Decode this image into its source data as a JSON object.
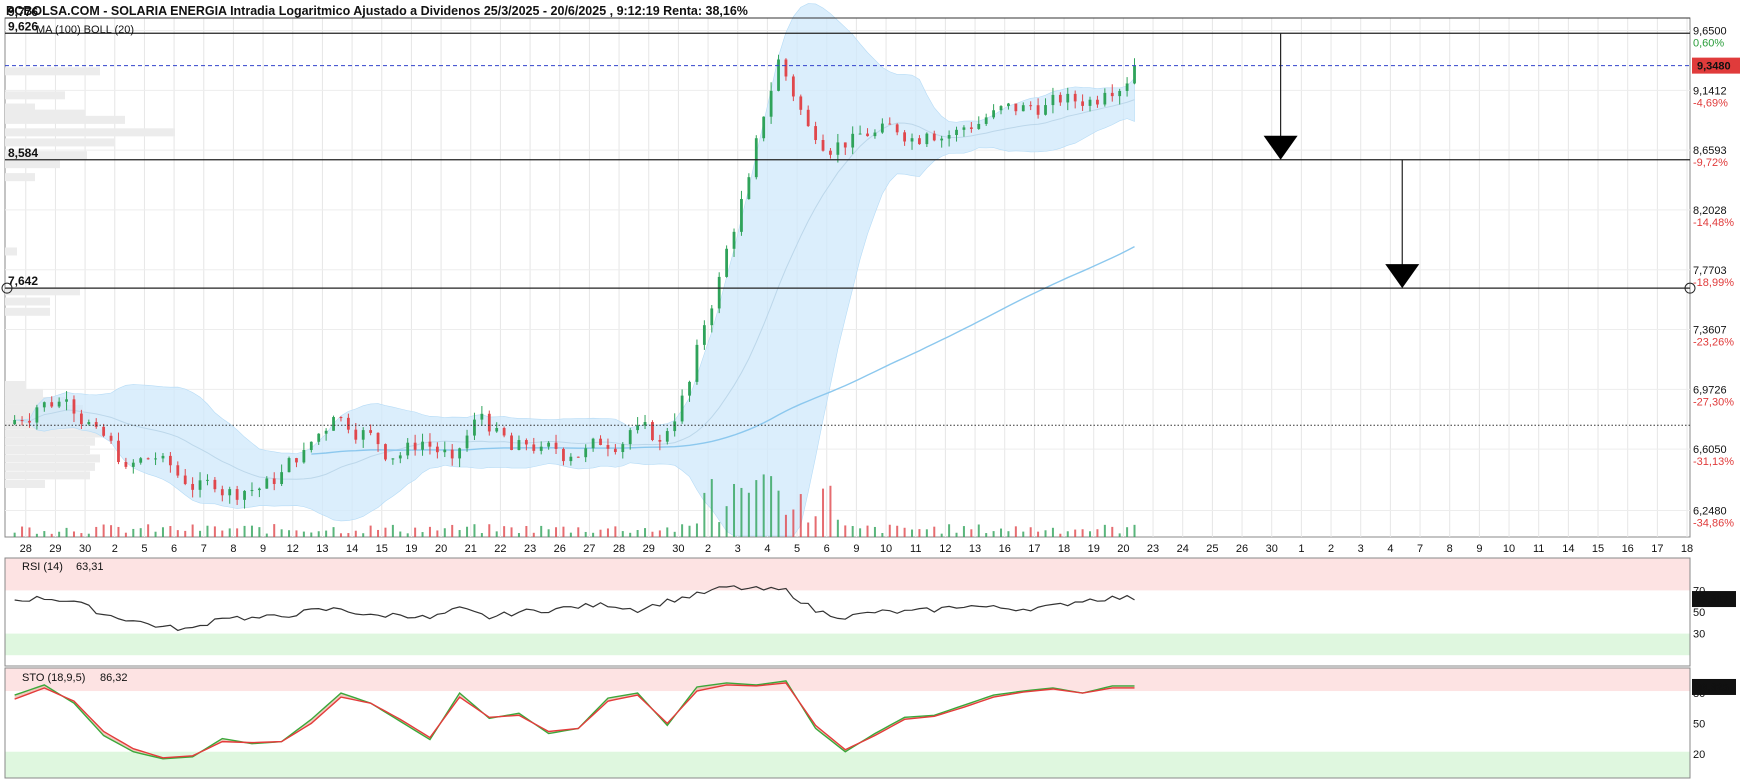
{
  "title": "PCBOLSA.COM - SOLARIA ENERGIA Intradia Logaritmico Ajustado a Dividenos 25/3/2025 - 20/6/2025 , 9:12:19 Renta: 38,16%",
  "colors": {
    "up": "#2fa35a",
    "down": "#e0474c",
    "boll_fill": "#cfe8fb",
    "ma_line": "#8cc8ee",
    "rsi_line": "#333333",
    "sto_k": "#3aa83a",
    "sto_d": "#e43b3b",
    "overbought_band": "#fde3e3",
    "oversold_band": "#dff7df",
    "last_price_badge": "#e03b3b",
    "dashed_price": "#3344cc"
  },
  "chart_data": {
    "type": "candlestick",
    "scale": "log",
    "ylim": [
      6.1,
      9.76
    ],
    "y_ticks": [
      "9,6500",
      "9,1412",
      "8,6593",
      "8,2028",
      "7,7703",
      "7,3607",
      "6,9726",
      "6,6050",
      "6,2480"
    ],
    "y_ticks_pct": [
      "0,60%",
      "-4,69%",
      "-9,72%",
      "-14,48%",
      "-18,99%",
      "-23,26%",
      "-27,30%",
      "-31,13%",
      "-34,86%"
    ],
    "y_tick_values": [
      9.65,
      9.1412,
      8.6593,
      8.2028,
      7.7703,
      7.3607,
      6.9726,
      6.605,
      6.248
    ],
    "x_ticks": [
      "28",
      "29",
      "30",
      "2",
      "5",
      "6",
      "7",
      "8",
      "9",
      "12",
      "13",
      "14",
      "15",
      "19",
      "20",
      "21",
      "22",
      "23",
      "26",
      "27",
      "28",
      "29",
      "30",
      "2",
      "3",
      "4",
      "5",
      "6",
      "9",
      "10",
      "11",
      "12",
      "13",
      "16",
      "17",
      "18",
      "19",
      "20",
      "23",
      "24",
      "25",
      "26",
      "30",
      "1",
      "2",
      "3",
      "4",
      "7",
      "8",
      "9",
      "10",
      "11",
      "14",
      "15",
      "16",
      "17",
      "18"
    ],
    "data_days": 38,
    "levels": [
      {
        "label": "9,626",
        "value": 9.626
      },
      {
        "label": "8,584",
        "value": 8.584
      },
      {
        "label": "7,642",
        "value": 7.642
      }
    ],
    "top_label": "9,776",
    "upper_line_value": 9.76,
    "dotted_level_value": 6.75,
    "last_price": {
      "label": "9,3480",
      "value": 9.348
    },
    "arrows": [
      {
        "day_index": 42.3,
        "from": 9.626,
        "to": 8.584
      },
      {
        "day_index": 46.4,
        "from": 8.584,
        "to": 7.642
      }
    ],
    "overlay_legend": "MA (100) BOLL (20)",
    "daily_close": [
      6.86,
      6.91,
      6.74,
      6.5,
      6.55,
      6.4,
      6.37,
      6.36,
      6.4,
      6.6,
      6.8,
      6.72,
      6.55,
      6.65,
      6.55,
      6.82,
      6.6,
      6.62,
      6.56,
      6.63,
      6.72,
      6.65,
      7.02,
      7.72,
      8.45,
      9.4,
      8.85,
      8.72,
      8.77,
      8.8,
      8.79,
      8.82,
      8.92,
      8.97,
      9.02,
      9.05,
      9.12,
      9.348
    ],
    "rsi": {
      "label": "RSI (14)",
      "value": "63,31",
      "badge": "63,317",
      "ticks": [
        "70",
        "50",
        "30"
      ],
      "values": [
        61,
        63,
        60,
        48,
        42,
        36,
        34,
        46,
        44,
        46,
        51,
        53,
        46,
        48,
        44,
        53,
        45,
        50,
        52,
        55,
        57,
        52,
        60,
        66,
        73,
        71,
        70,
        51,
        45,
        50,
        50,
        52,
        56,
        54,
        53,
        55,
        61,
        63
      ]
    },
    "sto": {
      "label": "STO (18,9,5)",
      "value": "86,32",
      "badge": "86,325",
      "ticks": [
        "80",
        "50",
        "20"
      ],
      "k": [
        78,
        88,
        70,
        38,
        22,
        15,
        17,
        35,
        30,
        32,
        54,
        80,
        70,
        52,
        34,
        80,
        55,
        60,
        40,
        45,
        75,
        80,
        48,
        86,
        90,
        88,
        92,
        45,
        22,
        40,
        56,
        58,
        68,
        78,
        82,
        85,
        80,
        87
      ],
      "d": [
        74,
        85,
        72,
        42,
        25,
        16,
        18,
        32,
        31,
        32,
        50,
        76,
        70,
        54,
        36,
        76,
        56,
        58,
        42,
        45,
        72,
        78,
        50,
        82,
        88,
        87,
        90,
        48,
        24,
        38,
        54,
        57,
        66,
        76,
        81,
        84,
        80,
        85
      ]
    }
  }
}
